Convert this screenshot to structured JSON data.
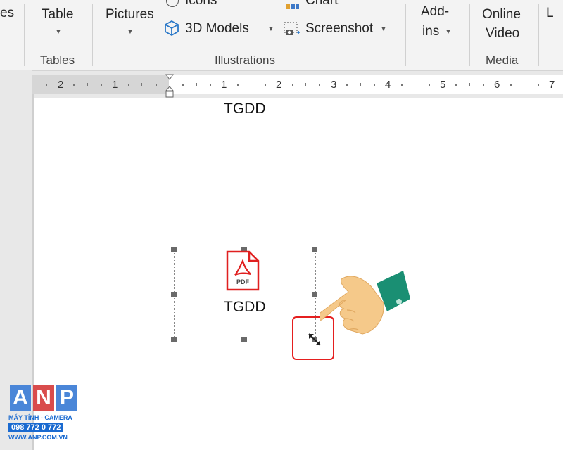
{
  "ribbon": {
    "partial_left": "es",
    "table_label": "Table",
    "tables_group": "Tables",
    "pictures_label": "Pictures",
    "icons_label": "Icons",
    "models_label": "3D Models",
    "chart_label": "Chart",
    "screenshot_label": "Screenshot",
    "illustrations_group": "Illustrations",
    "addins_line1": "Add-",
    "addins_line2": "ins",
    "online_line1": "Online",
    "online_line2": "Video",
    "media_group": "Media",
    "partial_right": "L"
  },
  "ruler": {
    "left_numbers": [
      "2",
      "1"
    ],
    "right_numbers": [
      "1",
      "2",
      "3",
      "4",
      "5",
      "6",
      "7"
    ]
  },
  "document": {
    "header_text": "TGDD",
    "object_caption": "TGDD",
    "pdf_icon_text": "PDF"
  },
  "logo": {
    "letters": [
      "A",
      "N",
      "P"
    ],
    "line1": "MÁY TÍNH - CAMERA",
    "line2": "098 772 0 772",
    "line3": "WWW.ANP.COM.VN"
  },
  "colors": {
    "accent_red": "#e51f1f",
    "logo_blue": "#1a6ad0",
    "cuff_green": "#1a8f73",
    "skin": "#f5c98a"
  },
  "icons": [
    "icons-icon",
    "3d-models-icon",
    "chart-icon",
    "screenshot-icon",
    "pdf-file-icon",
    "resize-cursor-icon",
    "pointing-hand-icon"
  ]
}
